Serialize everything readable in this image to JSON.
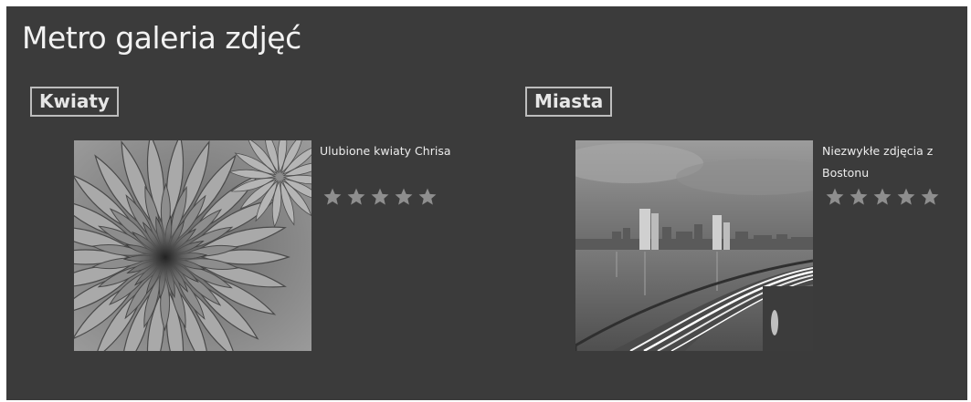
{
  "app": {
    "title": "Metro galeria zdjęć"
  },
  "groups": [
    {
      "header": "Kwiaty",
      "item": {
        "title": "Ulubione kwiaty Chrisa",
        "rating_max": 5,
        "rating_value": 0,
        "image": "flower-photo"
      }
    },
    {
      "header": "Miasta",
      "item": {
        "title": "Niezwykłe zdjęcia z Bostonu",
        "rating_max": 5,
        "rating_value": 0,
        "image": "boston-skyline-photo"
      }
    }
  ],
  "colors": {
    "background": "#3b3b3b",
    "text": "#f2f2f2",
    "star_empty": "#8e8e8e",
    "header_border": "#bdbdbd"
  }
}
